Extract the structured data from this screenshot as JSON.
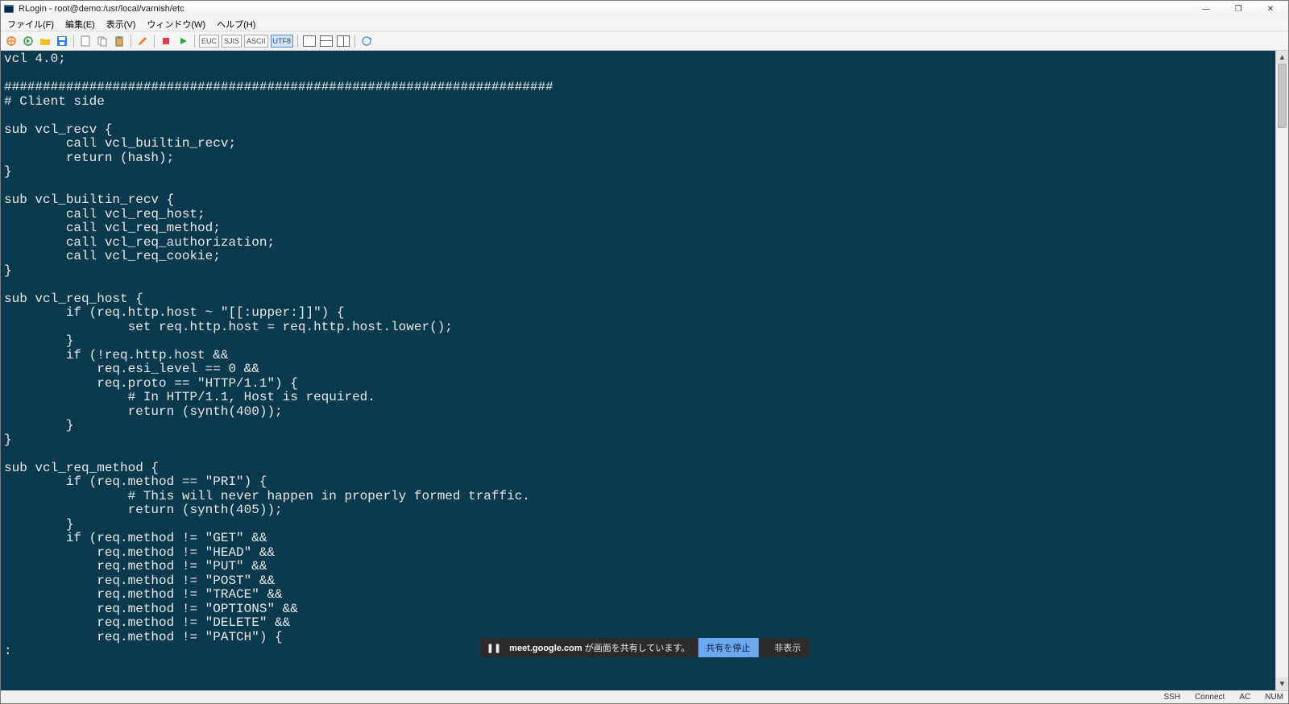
{
  "app_title": "RLogin - root@demo:/usr/local/varnish/etc",
  "window_controls": {
    "minimize": "—",
    "maximize": "❐",
    "close": "✕"
  },
  "menu": [
    "ファイル(F)",
    "編集(E)",
    "表示(V)",
    "ウィンドウ(W)",
    "ヘルプ(H)"
  ],
  "encodings": [
    "EUC",
    "SJIS",
    "ASCII",
    "UTF8"
  ],
  "active_encoding": "UTF8",
  "terminal_lines": [
    "vcl 4.0;",
    "",
    "#######################################################################",
    "# Client side",
    "",
    "sub vcl_recv {",
    "        call vcl_builtin_recv;",
    "        return (hash);",
    "}",
    "",
    "sub vcl_builtin_recv {",
    "        call vcl_req_host;",
    "        call vcl_req_method;",
    "        call vcl_req_authorization;",
    "        call vcl_req_cookie;",
    "}",
    "",
    "sub vcl_req_host {",
    "        if (req.http.host ~ \"[[:upper:]]\") {",
    "                set req.http.host = req.http.host.lower();",
    "        }",
    "        if (!req.http.host &&",
    "            req.esi_level == 0 &&",
    "            req.proto == \"HTTP/1.1\") {",
    "                # In HTTP/1.1, Host is required.",
    "                return (synth(400));",
    "        }",
    "}",
    "",
    "sub vcl_req_method {",
    "        if (req.method == \"PRI\") {",
    "                # This will never happen in properly formed traffic.",
    "                return (synth(405));",
    "        }",
    "        if (req.method != \"GET\" &&",
    "            req.method != \"HEAD\" &&",
    "            req.method != \"PUT\" &&",
    "            req.method != \"POST\" &&",
    "            req.method != \"TRACE\" &&",
    "            req.method != \"OPTIONS\" &&",
    "            req.method != \"DELETE\" &&",
    "            req.method != \"PATCH\") {",
    ":"
  ],
  "statusbar": {
    "ssh": "SSH",
    "connect": "Connect",
    "ac": "AC",
    "num": "NUM"
  },
  "sharebar": {
    "pause": "❚❚",
    "domain": "meet.google.com",
    "message": "が画面を共有しています。",
    "stop": "共有を停止",
    "hide": "非表示"
  }
}
